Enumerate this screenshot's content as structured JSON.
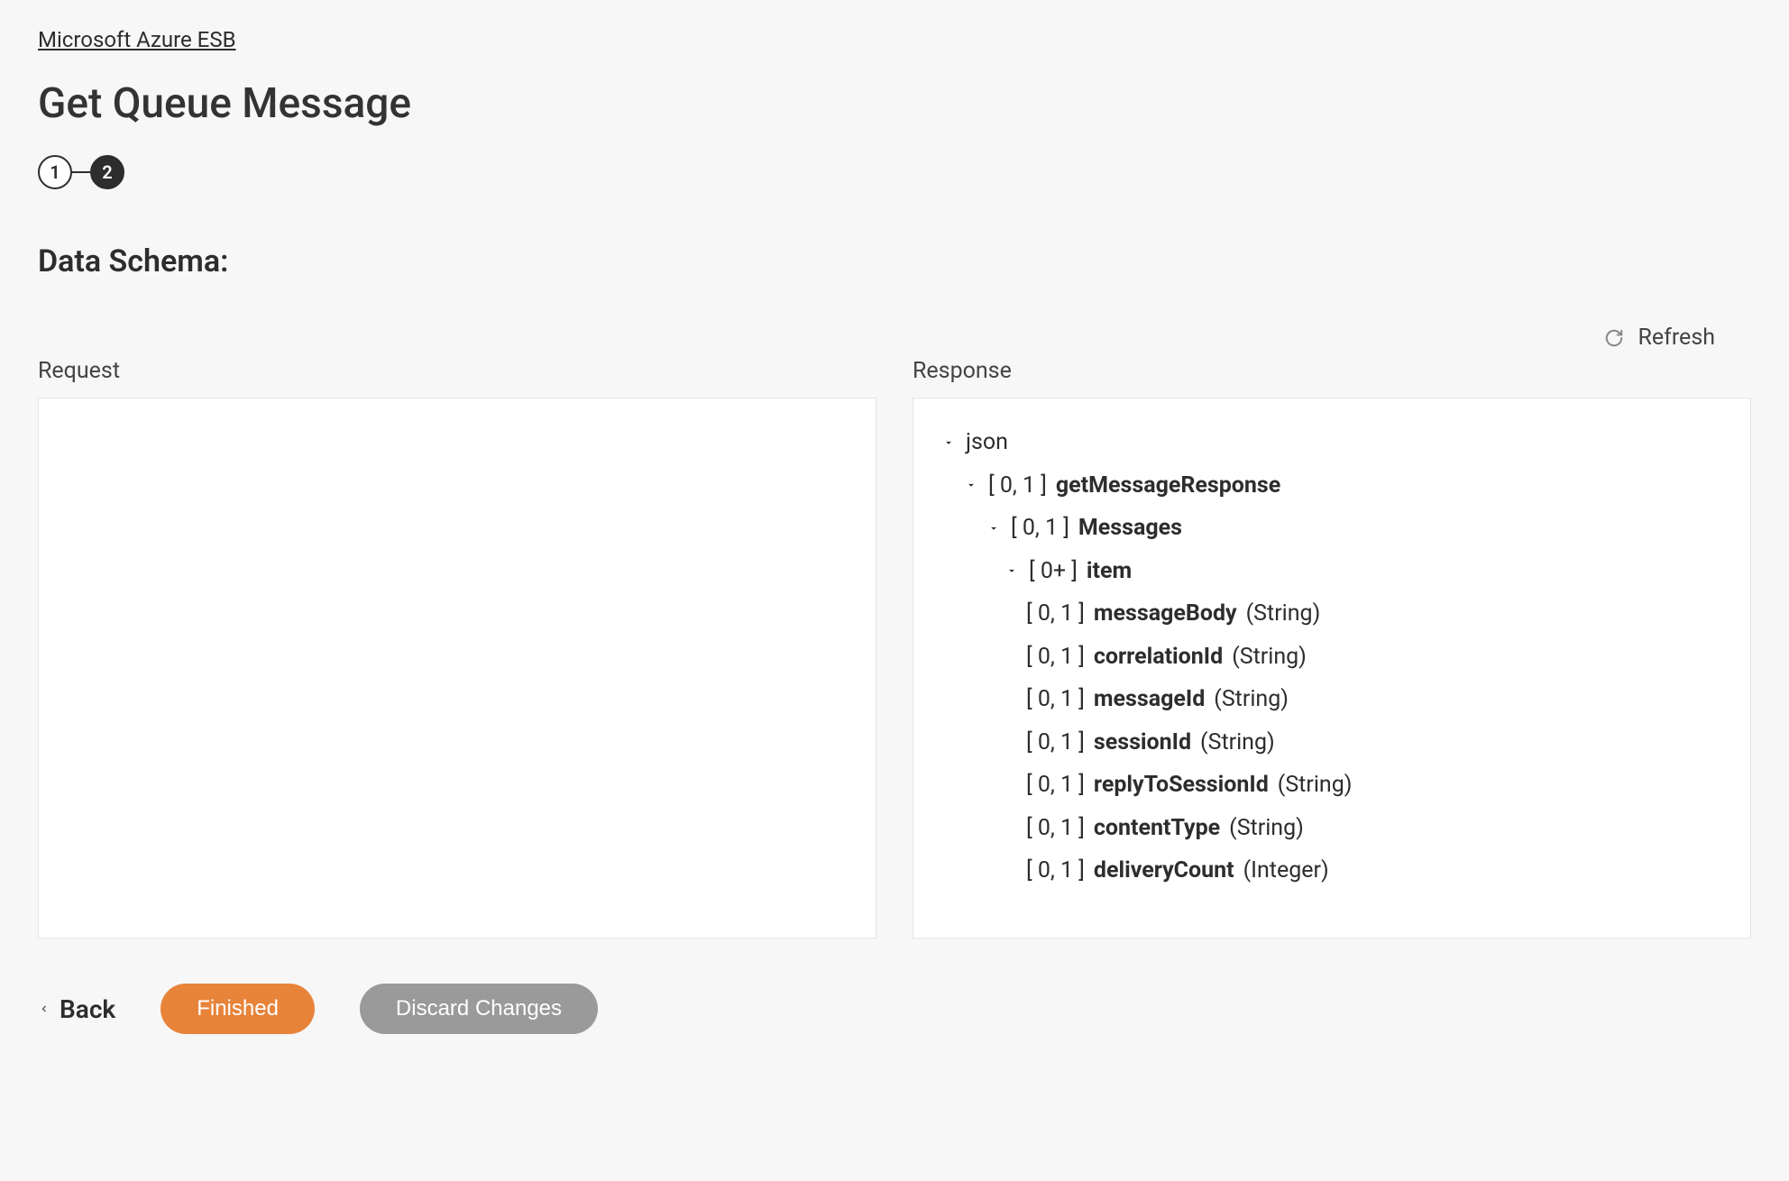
{
  "breadcrumb": {
    "label": "Microsoft Azure ESB"
  },
  "page_title": "Get Queue Message",
  "stepper": {
    "steps": [
      "1",
      "2"
    ],
    "active_index": 1
  },
  "section_heading": "Data Schema:",
  "refresh_label": "Refresh",
  "panels": {
    "request_label": "Request",
    "response_label": "Response"
  },
  "response_tree": {
    "root_label": "json",
    "nodes": [
      {
        "indent": 0,
        "chevron": true,
        "cardinality": "",
        "name_plain": "json",
        "name": "",
        "type": ""
      },
      {
        "indent": 1,
        "chevron": true,
        "cardinality": "[ 0, 1 ]",
        "name": "getMessageResponse",
        "type": ""
      },
      {
        "indent": 2,
        "chevron": true,
        "cardinality": "[ 0, 1 ]",
        "name": "Messages",
        "type": ""
      },
      {
        "indent": 3,
        "chevron": true,
        "cardinality": "[ 0+ ]",
        "name": "item",
        "type": ""
      },
      {
        "indent": 4,
        "chevron": false,
        "cardinality": "[ 0, 1 ]",
        "name": "messageBody",
        "type": "(String)"
      },
      {
        "indent": 4,
        "chevron": false,
        "cardinality": "[ 0, 1 ]",
        "name": "correlationId",
        "type": "(String)"
      },
      {
        "indent": 4,
        "chevron": false,
        "cardinality": "[ 0, 1 ]",
        "name": "messageId",
        "type": "(String)"
      },
      {
        "indent": 4,
        "chevron": false,
        "cardinality": "[ 0, 1 ]",
        "name": "sessionId",
        "type": "(String)"
      },
      {
        "indent": 4,
        "chevron": false,
        "cardinality": "[ 0, 1 ]",
        "name": "replyToSessionId",
        "type": "(String)"
      },
      {
        "indent": 4,
        "chevron": false,
        "cardinality": "[ 0, 1 ]",
        "name": "contentType",
        "type": "(String)"
      },
      {
        "indent": 4,
        "chevron": false,
        "cardinality": "[ 0, 1 ]",
        "name": "deliveryCount",
        "type": "(Integer)"
      }
    ]
  },
  "footer": {
    "back_label": "Back",
    "finished_label": "Finished",
    "discard_label": "Discard Changes"
  }
}
